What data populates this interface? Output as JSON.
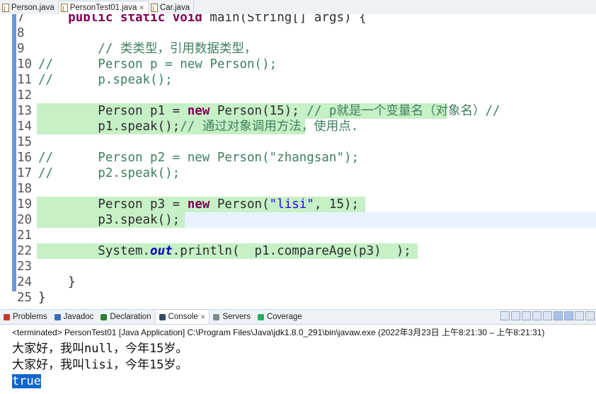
{
  "tabs": [
    {
      "label": "Person.java",
      "active": false,
      "closable": false
    },
    {
      "label": "PersonTest01.java",
      "active": true,
      "closable": true
    },
    {
      "label": "Car.java",
      "active": false,
      "closable": false
    }
  ],
  "editor": {
    "lines": [
      {
        "n": "7",
        "tokens": [
          {
            "t": "    "
          },
          {
            "t": "public",
            "c": "kw"
          },
          {
            "t": " "
          },
          {
            "t": "static",
            "c": "kw"
          },
          {
            "t": " "
          },
          {
            "t": "void",
            "c": "kw"
          },
          {
            "t": " main(String[] args) {"
          }
        ]
      },
      {
        "n": "8",
        "tokens": []
      },
      {
        "n": "9",
        "tokens": [
          {
            "t": "        "
          },
          {
            "t": "// 类类型，引用数据类型，",
            "c": "cm"
          }
        ]
      },
      {
        "n": "10",
        "tokens": [
          {
            "t": "//      ",
            "c": "cm"
          },
          {
            "t": "Person p = new Person();",
            "c": "cm"
          }
        ]
      },
      {
        "n": "11",
        "tokens": [
          {
            "t": "//      ",
            "c": "cm"
          },
          {
            "t": "p.speak();",
            "c": "cm"
          }
        ]
      },
      {
        "n": "12",
        "tokens": []
      },
      {
        "n": "13",
        "hl": true,
        "tokens": [
          {
            "t": "        Person p1 = "
          },
          {
            "t": "new",
            "c": "kw"
          },
          {
            "t": " Person(15); "
          },
          {
            "t": "// p就是一个变量名（对象名）//",
            "c": "cm"
          }
        ]
      },
      {
        "n": "14",
        "hl": true,
        "tokens": [
          {
            "t": "        p1.speak();"
          },
          {
            "t": "// 通过对象调用方法，使用点.",
            "c": "cm"
          }
        ]
      },
      {
        "n": "15",
        "tokens": []
      },
      {
        "n": "16",
        "tokens": [
          {
            "t": "//      ",
            "c": "cm"
          },
          {
            "t": "Person p2 = new Person(\"zhangsan\");",
            "c": "cm"
          }
        ]
      },
      {
        "n": "17",
        "tokens": [
          {
            "t": "//      ",
            "c": "cm"
          },
          {
            "t": "p2.speak();",
            "c": "cm"
          }
        ]
      },
      {
        "n": "18",
        "tokens": []
      },
      {
        "n": "19",
        "hl": true,
        "tokens": [
          {
            "t": "        Person p3 = "
          },
          {
            "t": "new",
            "c": "kw"
          },
          {
            "t": " Person("
          },
          {
            "t": "\"lisi\"",
            "c": "st"
          },
          {
            "t": ", 15);"
          }
        ]
      },
      {
        "n": "20",
        "hl": true,
        "current": true,
        "tokens": [
          {
            "t": "        p3.speak();"
          }
        ]
      },
      {
        "n": "21",
        "tokens": []
      },
      {
        "n": "22",
        "hl": true,
        "tokens": [
          {
            "t": "        System."
          },
          {
            "t": "out",
            "c": "fld"
          },
          {
            "t": ".println(  p1.compareAge(p3)  );"
          }
        ]
      },
      {
        "n": "23",
        "tokens": []
      },
      {
        "n": "24",
        "tokens": [
          {
            "t": "    }"
          }
        ]
      },
      {
        "n": "25",
        "tokens": [
          {
            "t": "}"
          }
        ]
      }
    ]
  },
  "views": {
    "tabs": [
      {
        "label": "Problems",
        "icon": "problems-icon",
        "active": false
      },
      {
        "label": "Javadoc",
        "icon": "javadoc-icon",
        "active": false
      },
      {
        "label": "Declaration",
        "icon": "declaration-icon",
        "active": false
      },
      {
        "label": "Console",
        "icon": "console-icon",
        "active": true
      },
      {
        "label": "Servers",
        "icon": "servers-icon",
        "active": false
      },
      {
        "label": "Coverage",
        "icon": "coverage-icon",
        "active": false
      }
    ]
  },
  "console": {
    "status": "<terminated> PersonTest01 [Java Application] C:\\Program Files\\Java\\jdk1.8.0_291\\bin\\javaw.exe  (2022年3月23日 上午8:21:30 – 上午8:21:31)",
    "output": [
      "大家好，我叫null，今年15岁。",
      "大家好，我叫lisi，今年15岁。",
      "true"
    ]
  },
  "colors": {
    "keyword": "#7f0055",
    "comment": "#3f7f5f",
    "string": "#2a00ff",
    "highlight": "#c6f0c6",
    "selection": "#1166cc"
  }
}
